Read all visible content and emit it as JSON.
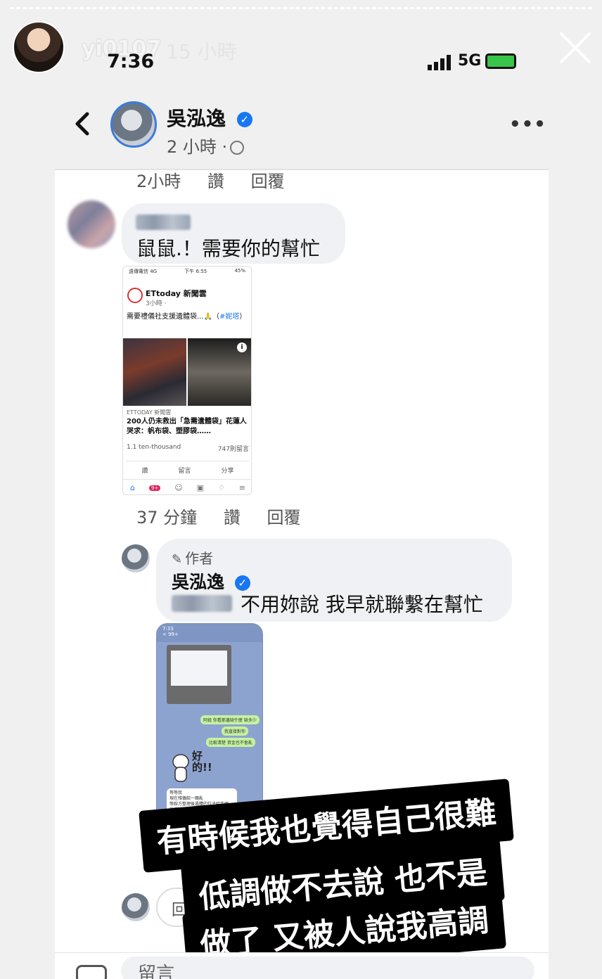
{
  "story": {
    "username": "yi0107",
    "posted_ago": "15 小時",
    "more": "···"
  },
  "status_bar": {
    "time": "7:36",
    "network": "5G"
  },
  "post_header": {
    "page_name": "吳泓逸",
    "timestamp": "2 小時 ·"
  },
  "comment1": {
    "meta": {
      "time": "2小時",
      "like": "讚",
      "reply": "回覆"
    },
    "text": "鼠鼠.！需要你的幫忙",
    "embedded": {
      "status_left": "遠傳電信 4G",
      "status_mid": "下午 6:55",
      "status_right": "45%",
      "page": "ETtoday 新聞雲",
      "time": "3小時 ·",
      "caption": "需要禮儀社支援遺體袋...🙏（",
      "hashtag": "#妮塔",
      "caption_end": "）",
      "source": "ETTODAY 新聞雲",
      "headline": "200人仍未救出「急需遺體袋」花蓮人哭求：帆布袋、塑膠袋……",
      "reactions": "1.1 ten-thousand",
      "comments": "747則留言",
      "like": "讚",
      "comment": "留言",
      "share": "分享",
      "badge": "9+"
    }
  },
  "comment1_footer": {
    "time": "37 分鐘",
    "like": "讚",
    "reply": "回覆"
  },
  "comment2": {
    "author_tag": "作者",
    "name": "吳泓逸",
    "text": "不用妳說 我早就聯繫在幫忙",
    "chat": {
      "time": "7:33",
      "back": "< 99+",
      "msg1": "阿姐 你看那邊缺什麼 缺多少",
      "msg2": "我直接對你",
      "msg3": "比較清楚 資金也不會亂",
      "sticker_text": "好的!!",
      "reply": "等等我\n現在殯儀館一團亂\n等館方整理後遺體的位子給我們\n我再統計給你"
    }
  },
  "overlay_caption": {
    "line1": "有時候我也覺得自己很難",
    "line2": "低調做不去說 也不是",
    "line3": "做了 又被人說我高調"
  },
  "composer": {
    "reply_placeholder": "回",
    "input_placeholder": "留言"
  },
  "colors": {
    "verified": "#1877f2",
    "line_chat_bg": "#8da3cf",
    "caption_bg": "#000000"
  }
}
